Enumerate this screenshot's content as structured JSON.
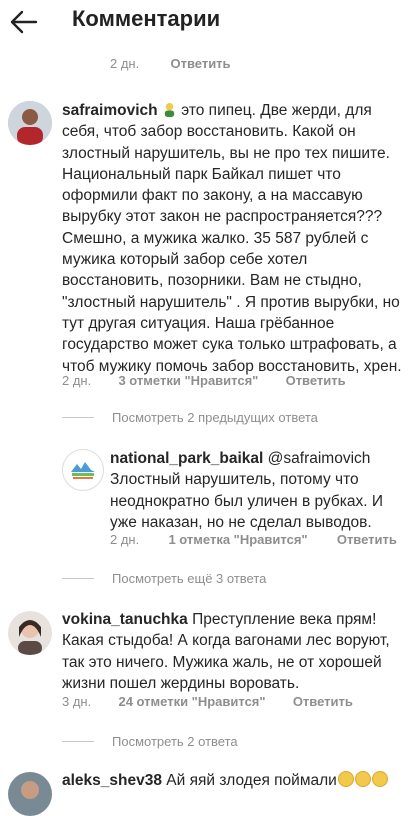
{
  "header": {
    "title": "Комментарии"
  },
  "top_meta": {
    "time": "2 дн.",
    "reply": "Ответить"
  },
  "comments": [
    {
      "user": "safraimovich",
      "text": "это пипец. Две жерди, для себя, чтоб забор восстановить. Какой он злостный нарушитель, вы не про тех пишите. Национальный парк Байкал пишет что оформили факт по закону, а на массавую вырубку этот закон не распространяется??? Смешно, а мужика жалко. 35 587 рублей с мужика который забор себе хотел восстановить, позорники. Вам не стыдно, \"злостный нарушитель\" . Я против вырубки, но тут другая ситуация. Наша грёбанное государство может сука только штрафовать, а чтоб мужику помочь забор восстановить, хрен.",
      "time": "2 дн.",
      "likes": "3 отметки \"Нравится\"",
      "reply": "Ответить",
      "view_replies": "Посмотреть 2 предыдущих ответа"
    },
    {
      "user": "national_park_baikal",
      "mention": "@safraimovich",
      "text": "Злостный нарушитель, потому что неоднократно был уличен в рубках. И уже наказан, но не сделал выводов.",
      "time": "2 дн.",
      "likes": "1 отметка \"Нравится\"",
      "reply": "Ответить",
      "view_more": "Посмотреть ещё 3 ответа"
    },
    {
      "user": "vokina_tanuchka",
      "text": "Преступление века прям! Какая стыдоба! А когда вагонами лес воруют, так это ничего. Мужика жаль, не от хорошей жизни пошел жердины воровать.",
      "time": "3 дн.",
      "likes": "24 отметки \"Нравится\"",
      "reply": "Ответить",
      "view_replies": "Посмотреть 2 ответа"
    },
    {
      "user": "aleks_shev38",
      "text": "Ай яяй злодея поймали"
    }
  ],
  "icons": {
    "back": "arrow-left-icon",
    "facepalm": "facepalm-emoji-icon",
    "laugh": "grinning-emoji-icon"
  },
  "colors": {
    "text": "#262626",
    "meta": "#8e8e8e",
    "separator": "#c7c7c7"
  }
}
